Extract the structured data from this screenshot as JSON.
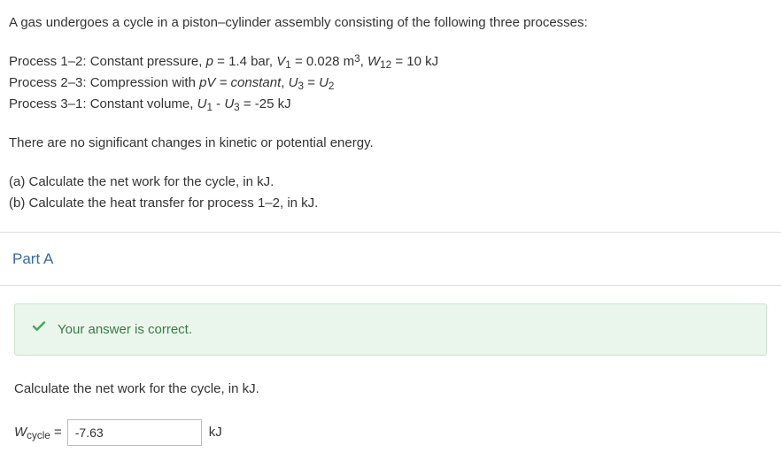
{
  "problem": {
    "intro": "A gas undergoes a cycle in a piston–cylinder assembly consisting of the following three processes:",
    "process12_label": "Process 1–2: Constant pressure, ",
    "process12_p": "p",
    "process12_eq1": " = 1.4 bar, ",
    "process12_V": "V",
    "process12_sub1": "1",
    "process12_eq2": " = 0.028 m",
    "process12_sup3": "3",
    "process12_comma": ", ",
    "process12_W": "W",
    "process12_sub12": "12",
    "process12_eq3": " = 10 kJ",
    "process23_label": "Process 2–3: Compression with ",
    "process23_pV": "pV",
    "process23_const": " = constant",
    "process23_comma": ", ",
    "process23_U3": "U",
    "process23_sub3": "3",
    "process23_eq": " = ",
    "process23_U2": "U",
    "process23_sub2": "2",
    "process31_label": "Process 3–1: Constant volume, ",
    "process31_U1": "U",
    "process31_sub1": "1",
    "process31_minus": " - ",
    "process31_U3": "U",
    "process31_sub3": "3",
    "process31_eq": " = -25 kJ",
    "energy_note": "There are no significant changes in kinetic or potential energy.",
    "question_a": "(a) Calculate the net work for the cycle, in kJ.",
    "question_b": "(b) Calculate the heat transfer for process 1–2, in kJ."
  },
  "partA": {
    "header": "Part A",
    "feedback": "Your answer is correct.",
    "prompt": "Calculate the net work for the cycle, in kJ.",
    "answer_var": "W",
    "answer_sub": "cycle",
    "answer_eq": " = ",
    "answer_value": "-7.63",
    "answer_unit": "kJ"
  }
}
